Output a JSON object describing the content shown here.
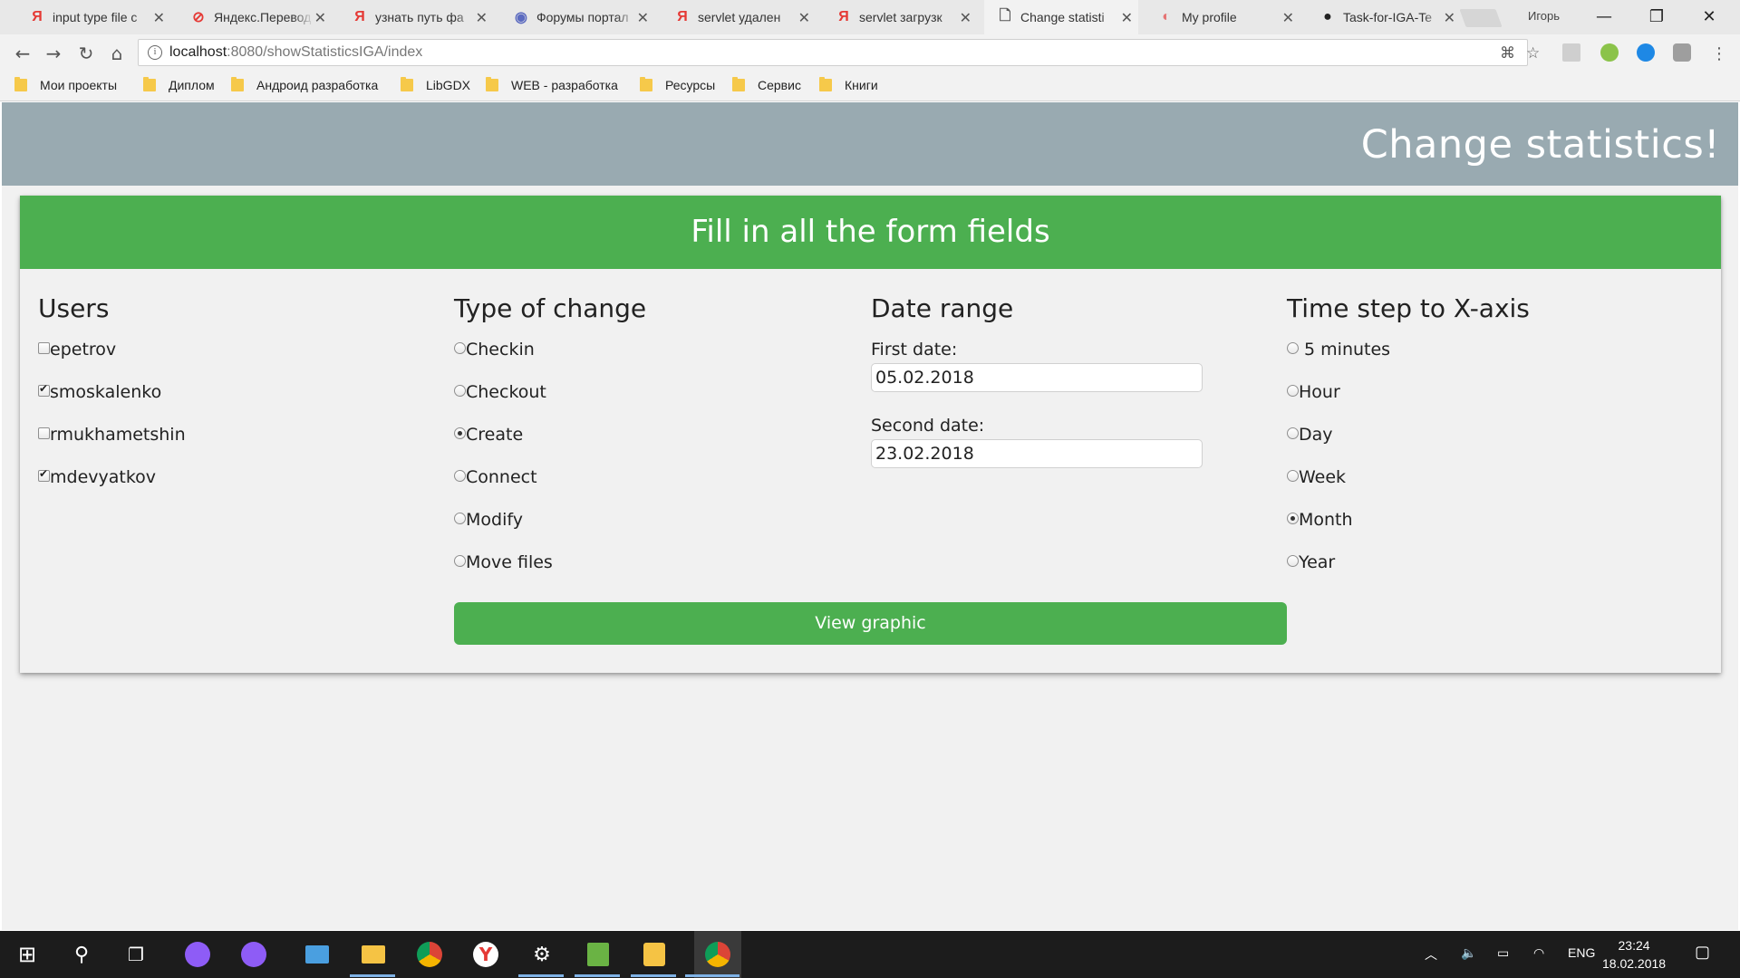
{
  "browser": {
    "tabs": [
      {
        "title": "input type file c",
        "favicon": "yandex-icon",
        "color": "#e53935"
      },
      {
        "title": "Яндекс.Перевод",
        "favicon": "yandex-translate-icon",
        "color": "#e53935"
      },
      {
        "title": "узнать путь фа",
        "favicon": "yandex-icon",
        "color": "#e53935"
      },
      {
        "title": "Форумы портал",
        "favicon": "forum-icon",
        "color": "#5c6bc0"
      },
      {
        "title": "servlet удален",
        "favicon": "yandex-icon",
        "color": "#e53935"
      },
      {
        "title": "servlet загрузк",
        "favicon": "yandex-icon",
        "color": "#e53935"
      },
      {
        "title": "Change statisti",
        "favicon": "page-icon",
        "color": "#555555"
      },
      {
        "title": "My profile",
        "favicon": "profile-icon",
        "color": "#e57373"
      },
      {
        "title": "Task-for-IGA-Te",
        "favicon": "github-icon",
        "color": "#222222"
      }
    ],
    "profile_name": "Игорь",
    "url_host": "localhost",
    "url_rest": ":8080/showStatisticsIGA/index",
    "bookmarks": [
      "Мои проекты",
      "Диплом",
      "Андроид разработка",
      "LibGDX",
      "WEB - разработка",
      "Ресурсы",
      "Сервис",
      "Книги"
    ]
  },
  "page": {
    "header_title": "Change statistics!",
    "form_title": "Fill in all the form fields",
    "users": {
      "heading": "Users",
      "items": [
        {
          "label": "epetrov",
          "checked": false
        },
        {
          "label": "smoskalenko",
          "checked": true
        },
        {
          "label": "rmukhametshin",
          "checked": false
        },
        {
          "label": "mdevyatkov",
          "checked": true
        }
      ]
    },
    "change_type": {
      "heading": "Type of change",
      "items": [
        {
          "label": "Checkin",
          "selected": false
        },
        {
          "label": "Checkout",
          "selected": false
        },
        {
          "label": "Create",
          "selected": true
        },
        {
          "label": "Connect",
          "selected": false
        },
        {
          "label": "Modify",
          "selected": false
        },
        {
          "label": "Move files",
          "selected": false
        }
      ]
    },
    "date_range": {
      "heading": "Date range",
      "first_label": "First date:",
      "first_value": "05.02.2018",
      "second_label": "Second date:",
      "second_value": "23.02.2018"
    },
    "time_step": {
      "heading": "Time step to X-axis",
      "items": [
        {
          "label": " 5 minutes",
          "selected": false
        },
        {
          "label": "Hour",
          "selected": false
        },
        {
          "label": "Day",
          "selected": false
        },
        {
          "label": "Week",
          "selected": false
        },
        {
          "label": "Month",
          "selected": true
        },
        {
          "label": "Year",
          "selected": false
        }
      ]
    },
    "view_button": "View graphic",
    "colors": {
      "header_bg": "#99aab1",
      "accent": "#4caf50"
    }
  },
  "taskbar": {
    "language": "ENG",
    "time": "23:24",
    "date": "18.02.2018"
  }
}
